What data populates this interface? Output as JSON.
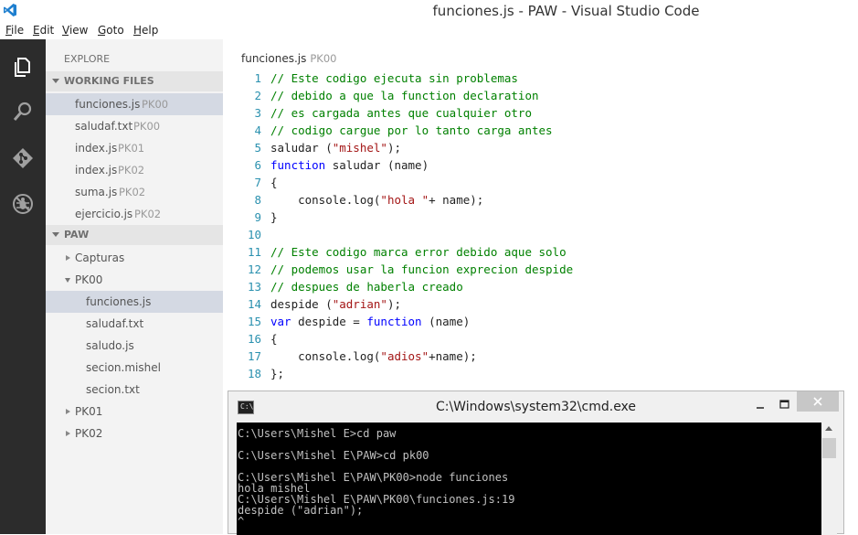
{
  "window": {
    "title": "funciones.js - PAW - Visual Studio Code"
  },
  "menu": [
    "File",
    "Edit",
    "View",
    "Goto",
    "Help"
  ],
  "sidebar": {
    "explore_label": "EXPLORE",
    "working_files_label": "WORKING FILES",
    "working_files": [
      {
        "name": "funciones.js",
        "tag": "PK00",
        "selected": true
      },
      {
        "name": "saludaf.txt",
        "tag": "PK00"
      },
      {
        "name": "index.js",
        "tag": "PK01"
      },
      {
        "name": "index.js",
        "tag": "PK02"
      },
      {
        "name": "suma.js",
        "tag": "PK02"
      },
      {
        "name": "ejercicio.js",
        "tag": "PK02"
      }
    ],
    "project_label": "PAW",
    "tree": {
      "capturas": "Capturas",
      "pk00": "PK00",
      "pk00_files": [
        "funciones.js",
        "saludaf.txt",
        "saludo.js",
        "secion.mishel",
        "secion.txt"
      ],
      "pk01": "PK01",
      "pk02": "PK02"
    }
  },
  "editor": {
    "tab_name": "funciones.js",
    "tab_tag": "PK00",
    "lines": [
      "// Este codigo ejecuta sin problemas",
      "// debido a que la function declaration",
      "// es cargada antes que cualquier otro",
      "// codigo cargue por lo tanto carga antes",
      "saludar (\"mishel\");",
      "function saludar (name)",
      "{",
      "    console.log(\"hola \"+ name);",
      "}",
      "",
      "// Este codigo marca error debido aque solo",
      "// podemos usar la funcion exprecion despide",
      "// despues de haberla creado",
      "despide (\"adrian\");",
      "var despide = function (name)",
      "{",
      "    console.log(\"adios\"+name);",
      "};"
    ]
  },
  "cmd": {
    "title": "C:\\Windows\\system32\\cmd.exe",
    "icon_text": "C:\\",
    "console_lines": [
      "C:\\Users\\Mishel E>cd paw",
      "",
      "C:\\Users\\Mishel E\\PAW>cd pk00",
      "",
      "C:\\Users\\Mishel E\\PAW\\PK00>node funciones",
      "hola mishel",
      "C:\\Users\\Mishel E\\PAW\\PK00\\funciones.js:19",
      "despide (\"adrian\");",
      "^"
    ]
  },
  "colors": {
    "activity_bg": "#2c2c2c",
    "sidebar_bg": "#f3f3f3",
    "selected_bg": "#d4d9e3",
    "line_number": "#2b91af",
    "comment": "#008000",
    "keyword": "#0000ff",
    "string": "#a31515"
  }
}
